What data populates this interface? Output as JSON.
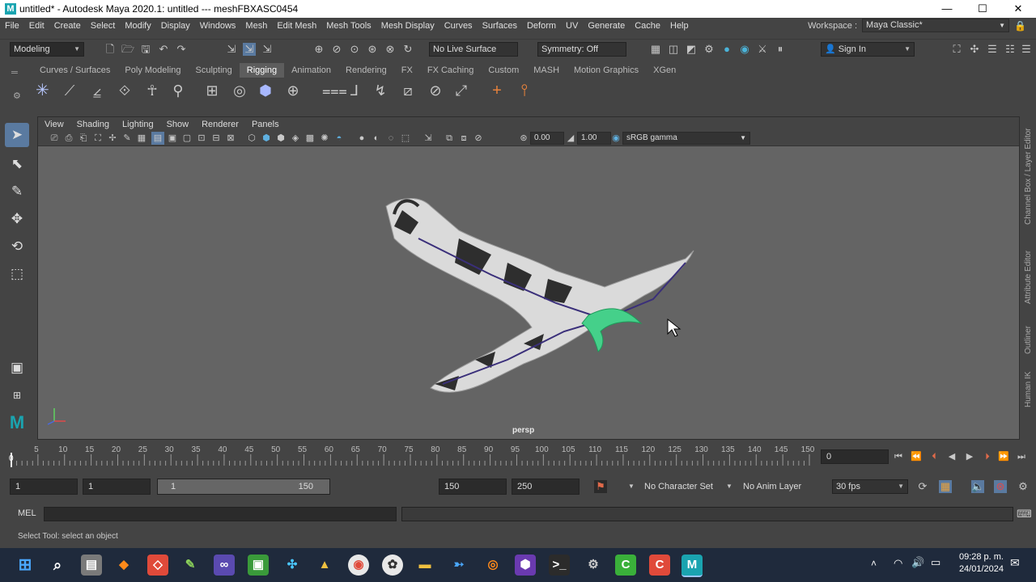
{
  "window": {
    "title": "untitled* - Autodesk Maya 2020.1: untitled   ---   meshFBXASC0454",
    "logo_letter": "M",
    "minimize": "—",
    "maximize": "☐",
    "close": "✕"
  },
  "menubar": [
    "File",
    "Edit",
    "Create",
    "Select",
    "Modify",
    "Display",
    "Windows",
    "Mesh",
    "Edit Mesh",
    "Mesh Tools",
    "Mesh Display",
    "Curves",
    "Surfaces",
    "Deform",
    "UV",
    "Generate",
    "Cache",
    "Help"
  ],
  "workspace": {
    "label": "Workspace :",
    "value": "Maya Classic*"
  },
  "statusline": {
    "mode": "Modeling",
    "live_surface": "No Live Surface",
    "symmetry": "Symmetry: Off",
    "sign_in": "Sign In"
  },
  "shelf": {
    "tabs": [
      "Curves / Surfaces",
      "Poly Modeling",
      "Sculpting",
      "Rigging",
      "Animation",
      "Rendering",
      "FX",
      "FX Caching",
      "Custom",
      "MASH",
      "Motion Graphics",
      "XGen"
    ],
    "active_tab": "Rigging"
  },
  "viewport": {
    "menu": [
      "View",
      "Shading",
      "Lighting",
      "Show",
      "Renderer",
      "Panels"
    ],
    "exposure": "0.00",
    "gamma": "1.00",
    "color_space": "sRGB gamma",
    "camera": "persp"
  },
  "side_tabs": [
    "Channel Box / Layer Editor",
    "Attribute Editor",
    "Outliner",
    "Human IK"
  ],
  "timeline": {
    "ticks": [
      5,
      10,
      15,
      20,
      25,
      30,
      35,
      40,
      45,
      50,
      55,
      60,
      65,
      70,
      75,
      80,
      85,
      90,
      95,
      100,
      105,
      110,
      115,
      120,
      125,
      130,
      135,
      140,
      145,
      150
    ],
    "start_label": "0",
    "current_frame": "0"
  },
  "range": {
    "start": "1",
    "playback_start": "1",
    "slider_start": "1",
    "slider_end": "150",
    "playback_end": "150",
    "end": "250",
    "character_set": "No Character Set",
    "anim_layer": "No Anim Layer",
    "fps": "30 fps"
  },
  "command": {
    "label": "MEL"
  },
  "help_line": "Select Tool: select an object",
  "taskbar": {
    "time": "09:28 p. m.",
    "date": "24/01/2024"
  }
}
